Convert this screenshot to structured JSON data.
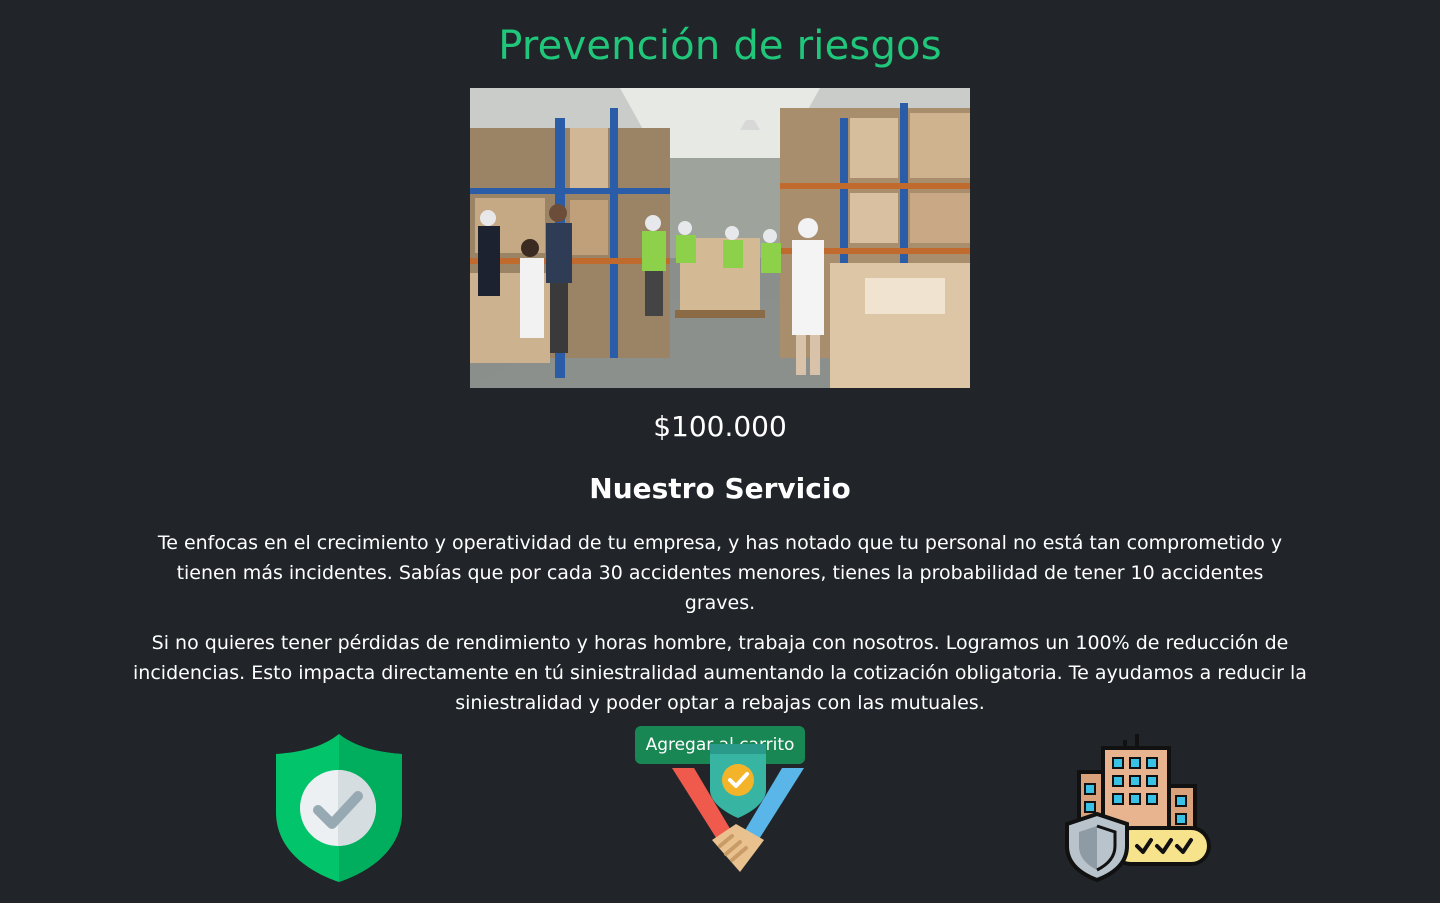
{
  "page": {
    "title": "Prevención de riesgos",
    "price": "$100.000",
    "section_heading": "Nuestro Servicio",
    "paragraphs": [
      "Te enfocas en el crecimiento y operatividad de tu empresa, y has notado que tu personal no está tan comprometido y tienen más incidentes. Sabías que por cada 30 accidentes menores, tienes la probabilidad de tener 10 accidentes graves.",
      "Si no quieres tener pérdidas de rendimiento y horas hombre, trabaja con nosotros. Logramos un 100% de reducción de incidencias. Esto impacta directamente en tú siniestralidad aumentando la cotización obligatoria. Te ayudamos a reducir la siniestralidad y poder optar a rebajas con las mutuales."
    ],
    "cart_button_label": "Agregar al carrito"
  },
  "hero_image": {
    "subject": "warehouse-team-photo",
    "alt": ""
  },
  "feature_icons": [
    "shield-check-icon",
    "handshake-shield-icon",
    "building-shield-icon"
  ],
  "colors": {
    "background": "#212529",
    "title": "#20c77b",
    "button": "#198754",
    "text": "#ffffff"
  }
}
